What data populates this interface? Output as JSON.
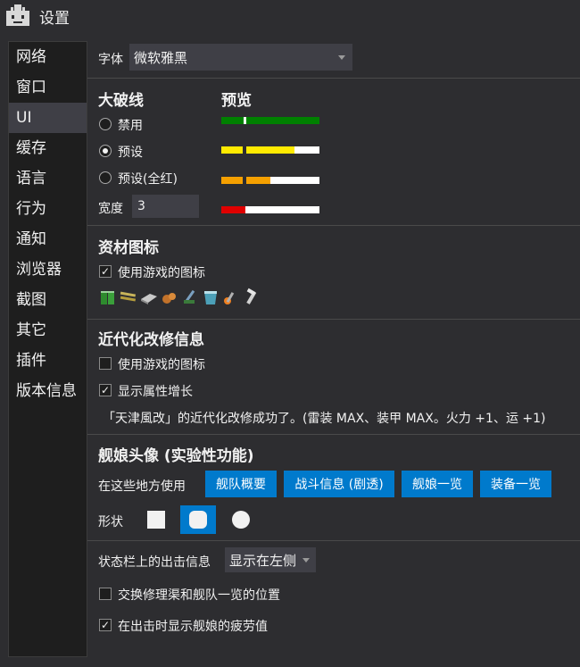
{
  "window": {
    "title": "设置",
    "icon": "gear-robot-icon"
  },
  "sidebar": {
    "items": [
      {
        "label": "网络",
        "active": false
      },
      {
        "label": "窗口",
        "active": false
      },
      {
        "label": "UI",
        "active": true
      },
      {
        "label": "缓存",
        "active": false
      },
      {
        "label": "语言",
        "active": false
      },
      {
        "label": "行为",
        "active": false
      },
      {
        "label": "通知",
        "active": false
      },
      {
        "label": "浏览器",
        "active": false
      },
      {
        "label": "截图",
        "active": false
      },
      {
        "label": "其它",
        "active": false
      },
      {
        "label": "插件",
        "active": false
      },
      {
        "label": "版本信息",
        "active": false
      }
    ]
  },
  "font": {
    "label": "字体",
    "value": "微软雅黑"
  },
  "hp_bar": {
    "title": "大破线",
    "preview_title": "预览",
    "options": [
      {
        "label": "禁用",
        "selected": false
      },
      {
        "label": "预设",
        "selected": true
      },
      {
        "label": "预设(全红)",
        "selected": false
      }
    ],
    "width_label": "宽度",
    "width_value": "3"
  },
  "colors": {
    "accent": "#007acc",
    "bar_green": "#008000",
    "bar_yellow": "#ffea00",
    "bar_orange": "#f5a000",
    "bar_red": "#e00000",
    "bar_white": "#ffffff"
  },
  "equipment_icons": {
    "title": "资材图标",
    "use_game_icons_label": "使用游戏的图标",
    "use_game_icons_checked": true,
    "icons": [
      "fuel-icon",
      "ammo-icon",
      "steel-icon",
      "bauxite-icon",
      "development-material-icon",
      "bucket-icon",
      "flamethrower-icon",
      "screw-icon"
    ]
  },
  "remodel": {
    "title": "近代化改修信息",
    "use_game_icons_label": "使用游戏的图标",
    "use_game_icons_checked": false,
    "show_growth_label": "显示属性增长",
    "show_growth_checked": true,
    "sample_text": "「天津風改」的近代化改修成功了。(雷装 MAX、装甲 MAX。火力 +1、运 +1)"
  },
  "avatar": {
    "title": "舰娘头像 (实验性功能)",
    "places_label": "在这些地方使用",
    "places": [
      "舰队概要",
      "战斗信息 (剧透)",
      "舰娘一览",
      "装备一览"
    ],
    "shape_label": "形状",
    "shapes": [
      "square",
      "rounded",
      "circle"
    ],
    "selected_shape": "rounded"
  },
  "statusbar": {
    "label": "状态栏上的出击信息",
    "value": "显示在左侧"
  },
  "swap_option": {
    "label": "交换修理渠和舰队一览的位置",
    "checked": false
  },
  "fatigue_option": {
    "label": "在出击时显示舰娘的疲劳值",
    "checked": true
  }
}
